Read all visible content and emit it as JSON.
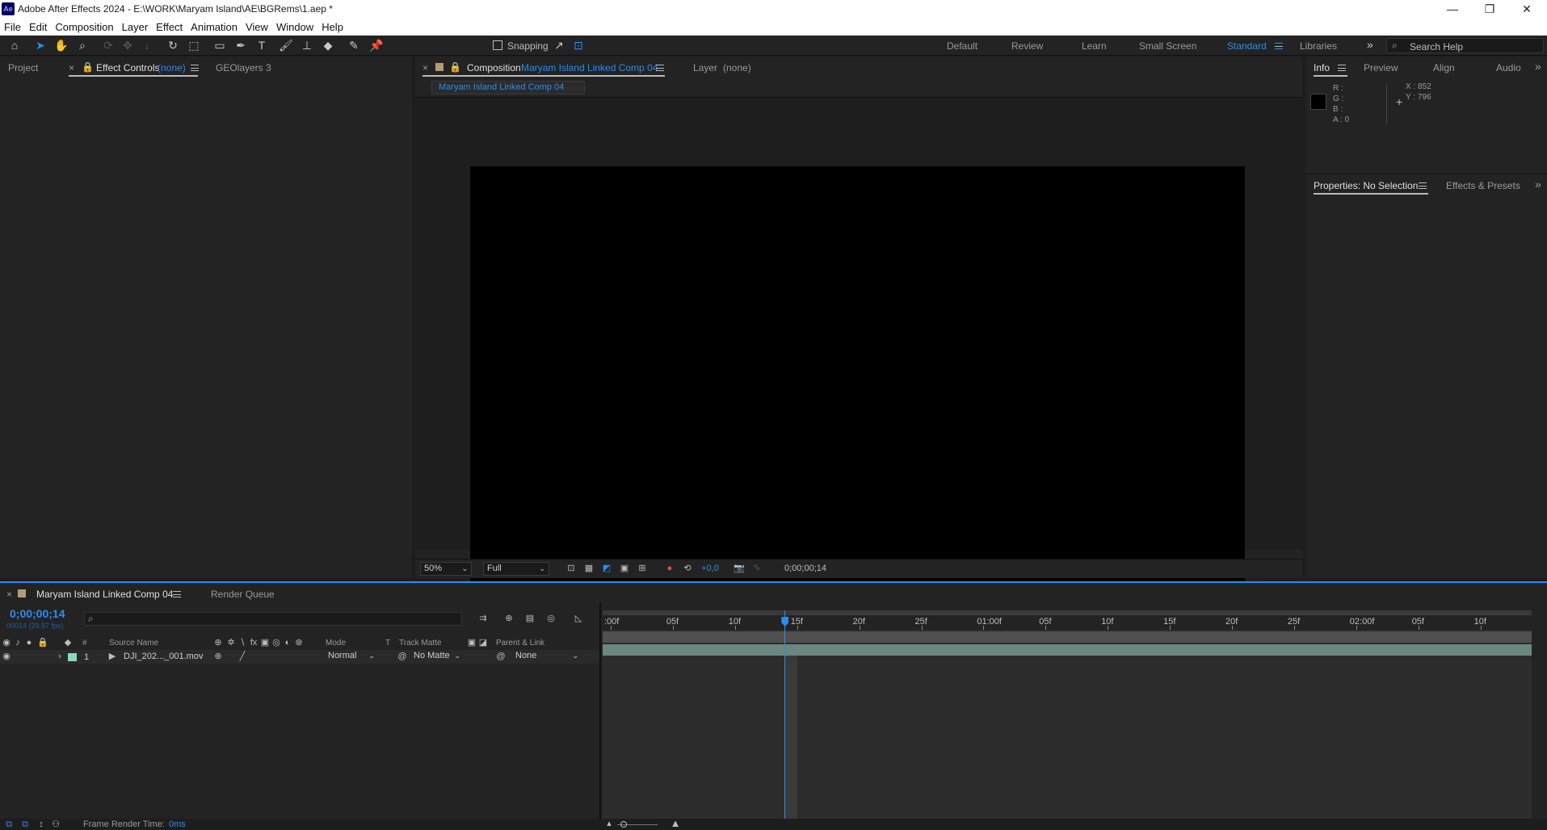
{
  "window": {
    "title": "Adobe After Effects 2024 - E:\\WORK\\Maryam Island\\AE\\BGRems\\1.aep *",
    "app_icon": "Ae",
    "min": "—",
    "max": "❐",
    "close": "✕"
  },
  "menu": [
    "File",
    "Edit",
    "Composition",
    "Layer",
    "Effect",
    "Animation",
    "View",
    "Window",
    "Help"
  ],
  "toolbar": {
    "snapping_label": "Snapping",
    "workspaces": [
      "Default",
      "Review",
      "Learn",
      "Small Screen",
      "Standard",
      "Libraries"
    ],
    "active_workspace": "Standard",
    "search_placeholder": "Search Help",
    "more": "»"
  },
  "left_panel": {
    "tabs": {
      "project": "Project",
      "effect_controls": "Effect Controls",
      "effect_controls_target": "(none)",
      "geolayers": "GEOlayers 3"
    }
  },
  "comp_panel": {
    "tab_label": "Composition",
    "comp_name": "Maryam Island Linked Comp 04",
    "layer_tab": "Layer",
    "layer_target": "(none)",
    "breadcrumb": "Maryam Island Linked Comp 04",
    "zoom": "50%",
    "resolution": "Full",
    "exposure": "+0,0",
    "timecode": "0;00;00;14",
    "close": "×"
  },
  "info_panel": {
    "tabs": [
      "Info",
      "Preview",
      "Align",
      "Audio"
    ],
    "r_label": "R :",
    "g_label": "G :",
    "b_label": "B :",
    "a_label": "A :",
    "a_value": "0",
    "x_label": "X : 852",
    "y_label": "Y : 796"
  },
  "properties_panel": {
    "tab": "Properties: No Selection",
    "effects_tab": "Effects & Presets"
  },
  "timeline": {
    "tab": "Maryam Island Linked Comp 04",
    "render_queue": "Render Queue",
    "current_time": "0;00;00;14",
    "frame_info": "00014 (29.97 fps)",
    "search_placeholder": "",
    "columns": {
      "num": "#",
      "source_name": "Source Name",
      "mode": "Mode",
      "t": "T",
      "track_matte": "Track Matte",
      "parent_link": "Parent & Link"
    },
    "ruler": [
      ":00f",
      "05f",
      "10f",
      "15f",
      "20f",
      "25f",
      "01:00f",
      "05f",
      "10f",
      "15f",
      "20f",
      "25f",
      "02:00f",
      "05f",
      "10f"
    ],
    "playhead_frame": 14,
    "layers": [
      {
        "num": "1",
        "name": "DJI_202..._001.mov",
        "mode": "Normal",
        "matte": "No Matte",
        "parent": "None",
        "label_color": "#8ad6c4"
      }
    ]
  },
  "statusbar": {
    "render_time_label": "Frame Render Time:",
    "render_time_value": "0ms"
  }
}
